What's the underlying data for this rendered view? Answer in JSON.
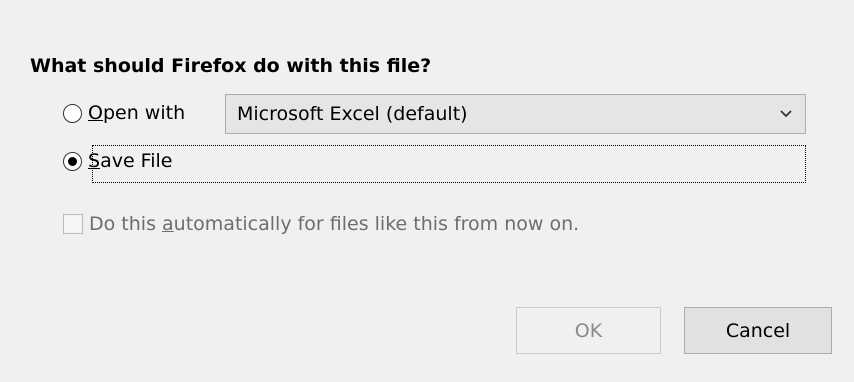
{
  "dialog": {
    "question": "What should Firefox do with this file?"
  },
  "open_with": {
    "access_key": "O",
    "label_rest": "pen with",
    "checked": false
  },
  "app_select": {
    "value": "Microsoft Excel (default)",
    "icon": "chevron-down-icon"
  },
  "save_file": {
    "access_key": "S",
    "label_rest": "ave File",
    "checked": true
  },
  "auto_checkbox": {
    "label_before": "Do this ",
    "access_key": "a",
    "label_after": "utomatically for files like this from now on.",
    "checked": false,
    "disabled": true
  },
  "buttons": {
    "ok": "OK",
    "cancel": "Cancel"
  },
  "colors": {
    "background": "#f0f0f0",
    "disabled_text": "#6d6d6d"
  }
}
